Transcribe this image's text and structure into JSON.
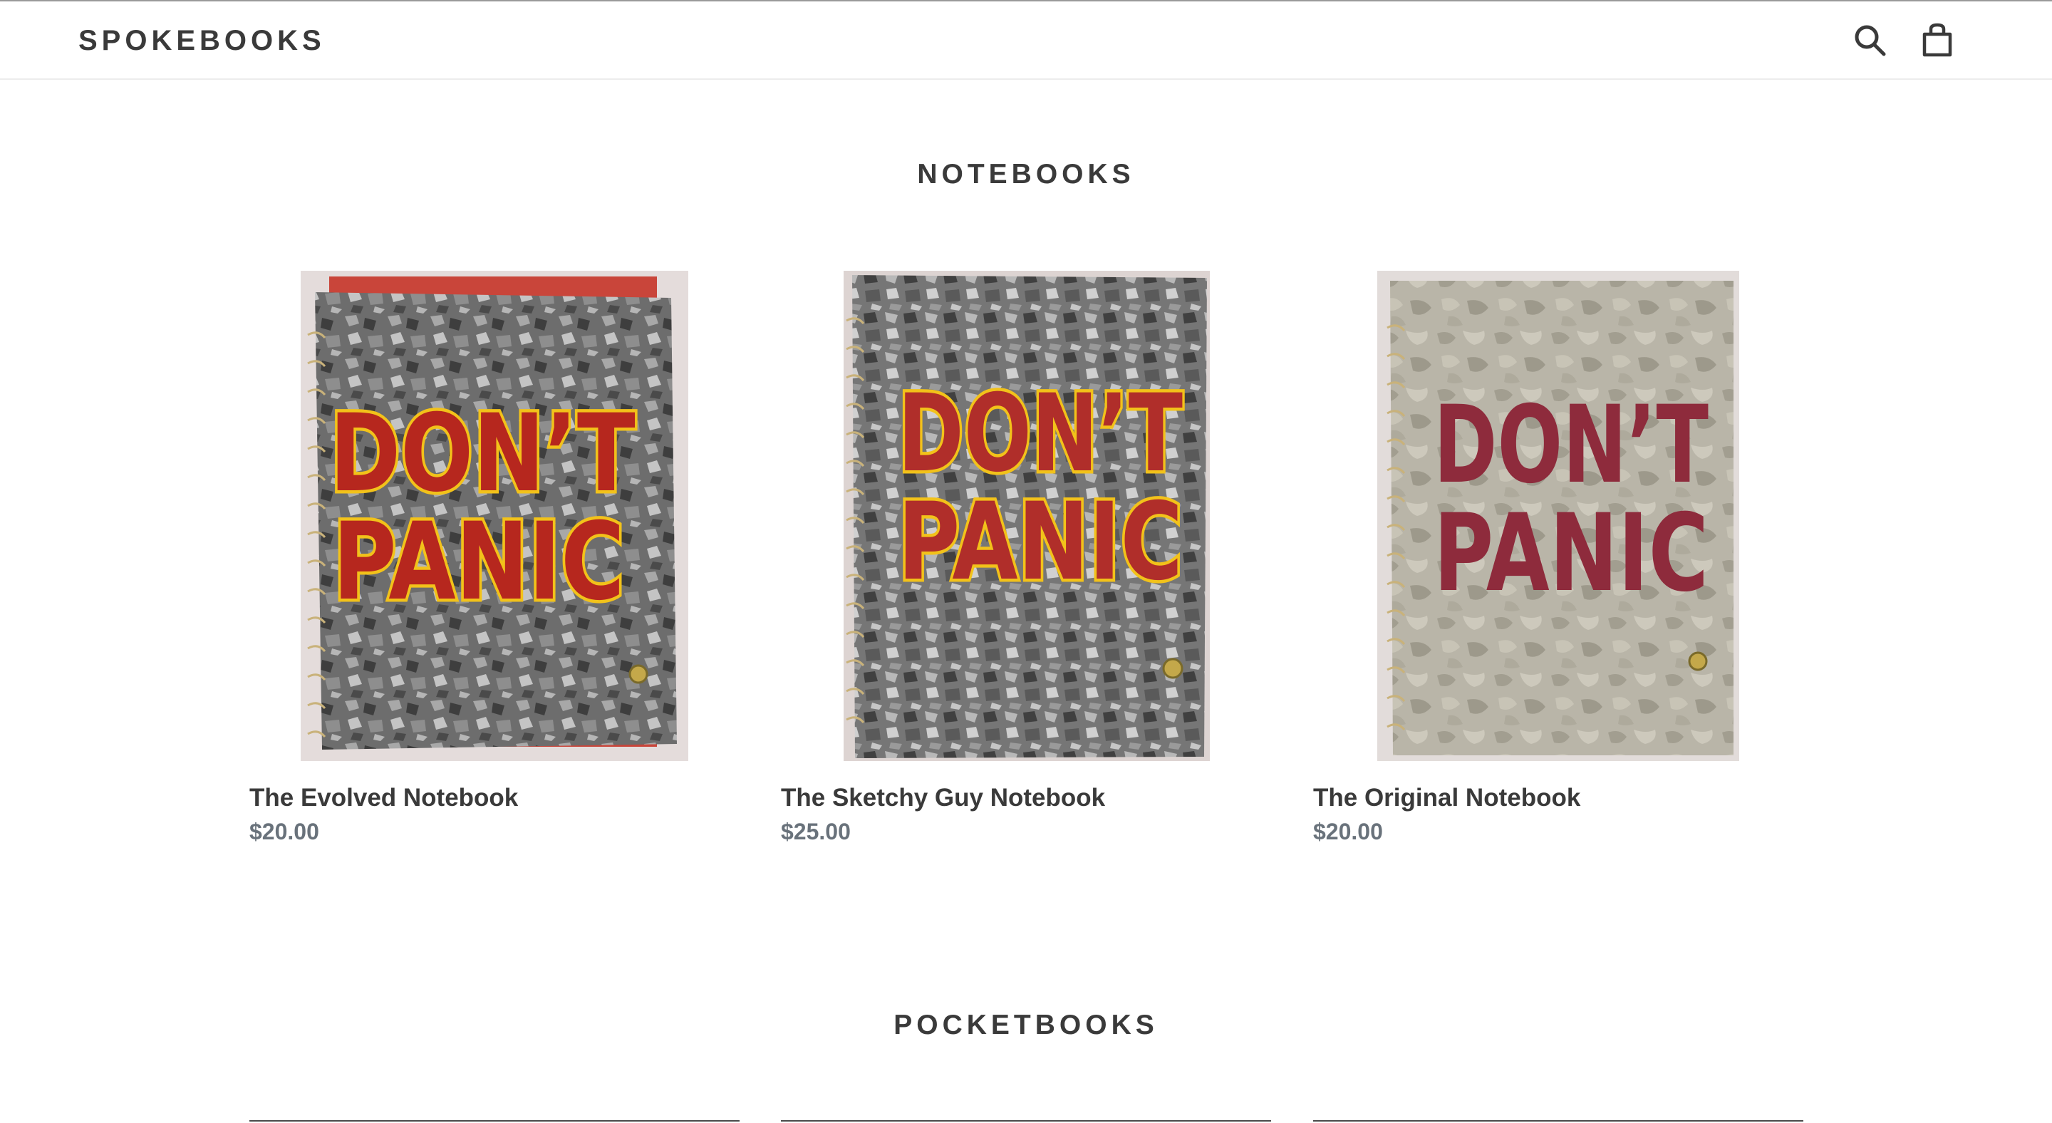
{
  "header": {
    "logo": "SPOKEBOOKS",
    "icons": [
      "search-icon",
      "cart-icon"
    ]
  },
  "sections": [
    {
      "title": "NOTEBOOKS",
      "products": [
        {
          "name": "The Evolved Notebook",
          "price": "$20.00",
          "cover_text": [
            "DON'T",
            "PANIC"
          ]
        },
        {
          "name": "The Sketchy Guy Notebook",
          "price": "$25.00",
          "cover_text": [
            "DON'T",
            "PANIC"
          ]
        },
        {
          "name": "The Original Notebook",
          "price": "$20.00",
          "cover_text": [
            "DON'T",
            "PANIC"
          ]
        }
      ]
    },
    {
      "title": "POCKETBOOKS"
    }
  ],
  "colors": {
    "text": "#3a3a3a",
    "price": "#69727b",
    "cover_red": "#c0281c",
    "cover_yellow": "#f2c21a",
    "cover_maroon": "#8e2b3c"
  }
}
